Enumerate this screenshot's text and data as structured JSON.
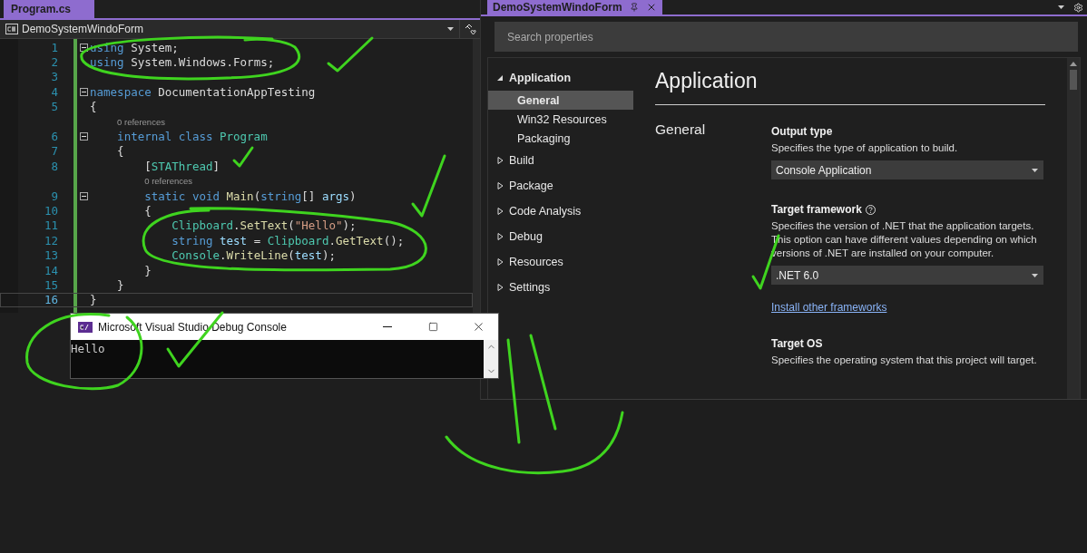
{
  "editor": {
    "tab": {
      "label": "Program.cs",
      "selected": true
    },
    "project_dropdown": {
      "value": "DemoSystemWindoForm"
    },
    "lines": [
      {
        "kind": "code",
        "number": "1",
        "expanded": true,
        "current": false,
        "tokens": [
          {
            "kind": "keyword",
            "text": "using"
          },
          {
            "kind": "plain",
            "text": " System;"
          }
        ]
      },
      {
        "kind": "code",
        "number": "2",
        "current": false,
        "tokens": [
          {
            "kind": "keyword",
            "text": "using"
          },
          {
            "kind": "plain",
            "text": " System.Windows.Forms;"
          }
        ]
      },
      {
        "kind": "code",
        "number": "3",
        "current": false
      },
      {
        "kind": "code",
        "number": "4",
        "expanded": true,
        "current": false,
        "tokens": [
          {
            "kind": "keyword",
            "text": "namespace"
          },
          {
            "kind": "plain",
            "text": " DocumentationAppTesting"
          }
        ]
      },
      {
        "kind": "code",
        "number": "5",
        "current": false,
        "tokens": [
          {
            "kind": "plain",
            "text": "{"
          }
        ]
      },
      {
        "kind": "lens",
        "text": "0 references"
      },
      {
        "kind": "code",
        "number": "6",
        "expanded": true,
        "current": false,
        "tokens": [
          {
            "kind": "keyword",
            "text": "    internal class"
          },
          {
            "kind": "type",
            "text": " Program"
          }
        ]
      },
      {
        "kind": "code",
        "number": "7",
        "current": false,
        "tokens": [
          {
            "kind": "plain",
            "text": "    {"
          }
        ]
      },
      {
        "kind": "code",
        "number": "8",
        "current": false,
        "tokens": [
          {
            "kind": "plain",
            "text": "        ["
          },
          {
            "kind": "type",
            "text": "STAThread"
          },
          {
            "kind": "plain",
            "text": "]"
          }
        ]
      },
      {
        "kind": "lens",
        "text": "0 references"
      },
      {
        "kind": "code",
        "number": "9",
        "expanded": true,
        "current": false,
        "tokens": [
          {
            "kind": "keyword",
            "text": "        static void"
          },
          {
            "kind": "method",
            "text": " Main"
          },
          {
            "kind": "plain",
            "text": "("
          },
          {
            "kind": "keyword",
            "text": "string"
          },
          {
            "kind": "plain",
            "text": "[] "
          },
          {
            "kind": "param",
            "text": "args"
          },
          {
            "kind": "plain",
            "text": ")"
          }
        ]
      },
      {
        "kind": "code",
        "number": "10",
        "current": false,
        "tokens": [
          {
            "kind": "plain",
            "text": "        {"
          }
        ]
      },
      {
        "kind": "code",
        "number": "11",
        "current": false,
        "tokens": [
          {
            "kind": "type",
            "text": "            Clipboard"
          },
          {
            "kind": "plain",
            "text": "."
          },
          {
            "kind": "method",
            "text": "SetText"
          },
          {
            "kind": "plain",
            "text": "("
          },
          {
            "kind": "string",
            "text": "\"Hello\""
          },
          {
            "kind": "plain",
            "text": ");"
          }
        ]
      },
      {
        "kind": "code",
        "number": "12",
        "current": false,
        "tokens": [
          {
            "kind": "keyword",
            "text": "            string"
          },
          {
            "kind": "param",
            "text": " test"
          },
          {
            "kind": "plain",
            "text": " = "
          },
          {
            "kind": "type",
            "text": "Clipboard"
          },
          {
            "kind": "plain",
            "text": "."
          },
          {
            "kind": "method",
            "text": "GetText"
          },
          {
            "kind": "plain",
            "text": "();"
          }
        ]
      },
      {
        "kind": "code",
        "number": "13",
        "current": false,
        "tokens": [
          {
            "kind": "type",
            "text": "            Console"
          },
          {
            "kind": "plain",
            "text": "."
          },
          {
            "kind": "method",
            "text": "WriteLine"
          },
          {
            "kind": "plain",
            "text": "("
          },
          {
            "kind": "param",
            "text": "test"
          },
          {
            "kind": "plain",
            "text": ");"
          }
        ]
      },
      {
        "kind": "code",
        "number": "14",
        "current": false,
        "tokens": [
          {
            "kind": "plain",
            "text": "        }"
          }
        ]
      },
      {
        "kind": "code",
        "number": "15",
        "current": false,
        "tokens": [
          {
            "kind": "plain",
            "text": "    }"
          }
        ]
      },
      {
        "kind": "code",
        "number": "16",
        "current": true,
        "tokens": [
          {
            "kind": "plain",
            "text": "}"
          }
        ]
      }
    ]
  },
  "properties": {
    "tab": {
      "label": "DemoSystemWindoForm",
      "selected": true
    },
    "search": {
      "placeholder": "Search properties"
    },
    "nav": [
      {
        "label": "Application",
        "expanded": true,
        "selected": false,
        "children": [
          {
            "label": "General",
            "selected": true
          },
          {
            "label": "Win32 Resources",
            "selected": false
          },
          {
            "label": "Packaging",
            "selected": false
          }
        ]
      },
      {
        "label": "Build",
        "expanded": false,
        "selected": false
      },
      {
        "label": "Package",
        "expanded": false,
        "selected": false
      },
      {
        "label": "Code Analysis",
        "expanded": false,
        "selected": false
      },
      {
        "label": "Debug",
        "expanded": false,
        "selected": false
      },
      {
        "label": "Resources",
        "expanded": false,
        "selected": false
      },
      {
        "label": "Settings",
        "expanded": false,
        "selected": false
      }
    ],
    "title": "Application",
    "section": "General",
    "fields": [
      {
        "kind": "dropdown",
        "label": "Output type",
        "description": "Specifies the type of application to build.",
        "value": "Console Application"
      },
      {
        "kind": "dropdown",
        "label": "Target framework",
        "help": true,
        "description": "Specifies the version of .NET that the application targets. This option can have different values depending on which versions of .NET are installed on your computer.",
        "value": ".NET 6.0",
        "link": "Install other frameworks"
      },
      {
        "kind": "text",
        "label": "Target OS",
        "description": "Specifies the operating system that this project will target."
      }
    ]
  },
  "console": {
    "title": "Microsoft Visual Studio Debug Console",
    "output": "Hello"
  }
}
